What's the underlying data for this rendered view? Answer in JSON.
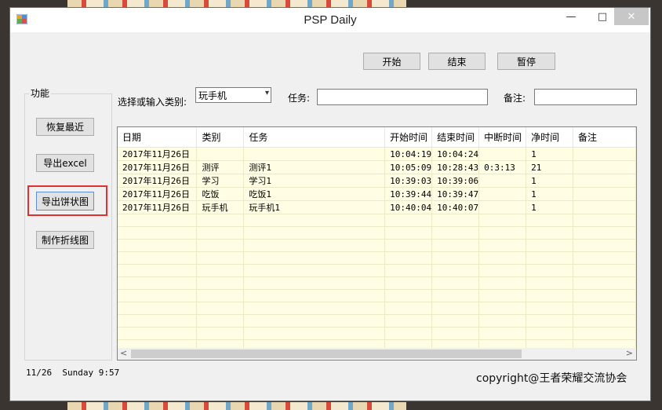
{
  "window": {
    "title": "PSP Daily",
    "minimize": "—",
    "maximize": "□",
    "close": "✕"
  },
  "timer_buttons": {
    "start": "开始",
    "end": "结束",
    "pause": "暂停"
  },
  "functions": {
    "group_label": "功能",
    "restore": "恢复最近",
    "export_excel": "导出excel",
    "export_pie": "导出饼状图",
    "make_line": "制作折线图"
  },
  "form": {
    "category_label": "选择或输入类别:",
    "category_value": "玩手机",
    "task_label": "任务:",
    "task_value": "",
    "note_label": "备注:",
    "note_value": ""
  },
  "table": {
    "columns": [
      "日期",
      "类别",
      "任务",
      "开始时间",
      "结束时间",
      "中断时间",
      "净时间",
      "备注"
    ],
    "rows": [
      [
        "2017年11月26日",
        "",
        "",
        "10:04:19",
        "10:04:24",
        "",
        "1",
        ""
      ],
      [
        "2017年11月26日",
        "测评",
        "测评1",
        "10:05:09",
        "10:28:43",
        "0:3:13",
        "21",
        ""
      ],
      [
        "2017年11月26日",
        "学习",
        "学习1",
        "10:39:03",
        "10:39:06",
        "",
        "1",
        ""
      ],
      [
        "2017年11月26日",
        "吃饭",
        "吃饭1",
        "10:39:44",
        "10:39:47",
        "",
        "1",
        ""
      ],
      [
        "2017年11月26日",
        "玩手机",
        "玩手机1",
        "10:40:04",
        "10:40:07",
        "",
        "1",
        ""
      ]
    ]
  },
  "status": {
    "date": "11/26",
    "day": "Sunday",
    "time": "9:57"
  },
  "copyright": "copyright@王者荣耀交流协会",
  "colors": {
    "grid_background": "#fffde3",
    "highlight_outline": "#e03030"
  }
}
